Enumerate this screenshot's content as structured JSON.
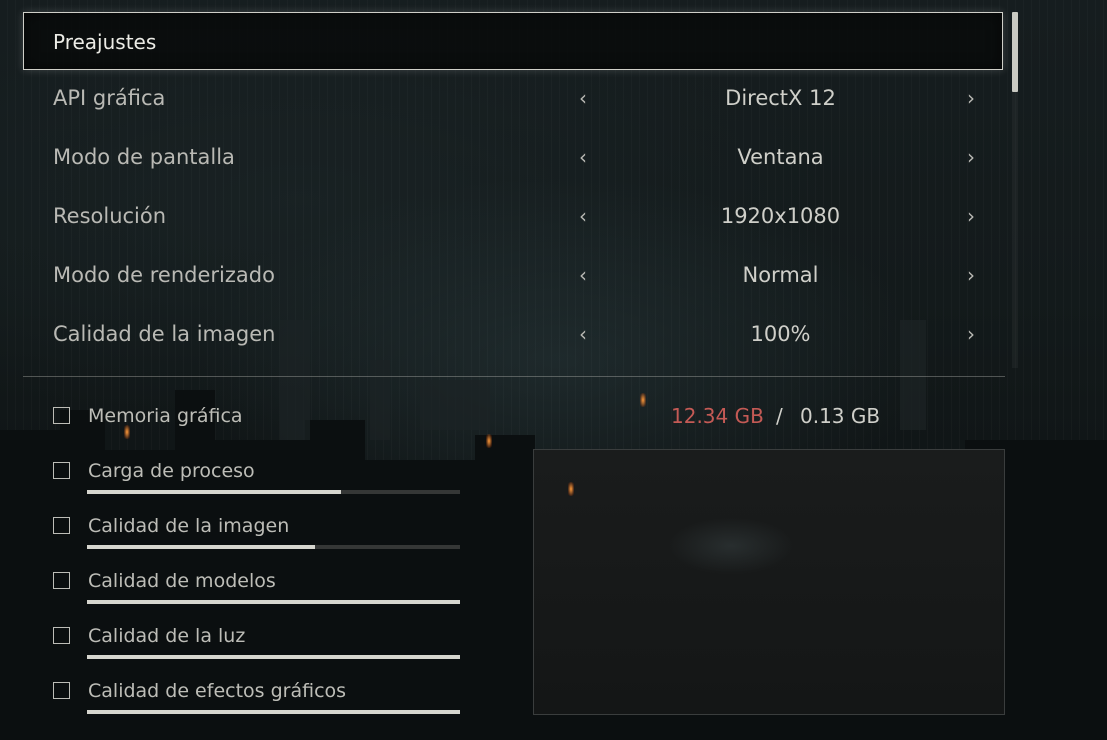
{
  "preset": {
    "label": "Preajustes"
  },
  "settings": [
    {
      "label": "API gráfica",
      "value": "DirectX 12"
    },
    {
      "label": "Modo de pantalla",
      "value": "Ventana"
    },
    {
      "label": "Resolución",
      "value": "1920x1080"
    },
    {
      "label": "Modo de renderizado",
      "value": "Normal"
    },
    {
      "label": "Calidad de la imagen",
      "value": "100%"
    }
  ],
  "arrows": {
    "left": "‹",
    "right": "›",
    "left_icon": "chevron-left-icon",
    "right_icon": "chevron-right-icon"
  },
  "memory": {
    "label": "Memoria gráfica",
    "used": "12.34 GB",
    "separator": "/",
    "total": "0.13 GB",
    "used_color": "#c45a55"
  },
  "load_items": [
    {
      "label": "Carga de proceso",
      "level": 0.68
    },
    {
      "label": "Calidad de la imagen",
      "level": 0.61
    },
    {
      "label": "Calidad de modelos",
      "level": 1.0
    },
    {
      "label": "Calidad de la luz",
      "level": 1.0
    },
    {
      "label": "Calidad de efectos gráficos",
      "level": 1.0
    }
  ]
}
